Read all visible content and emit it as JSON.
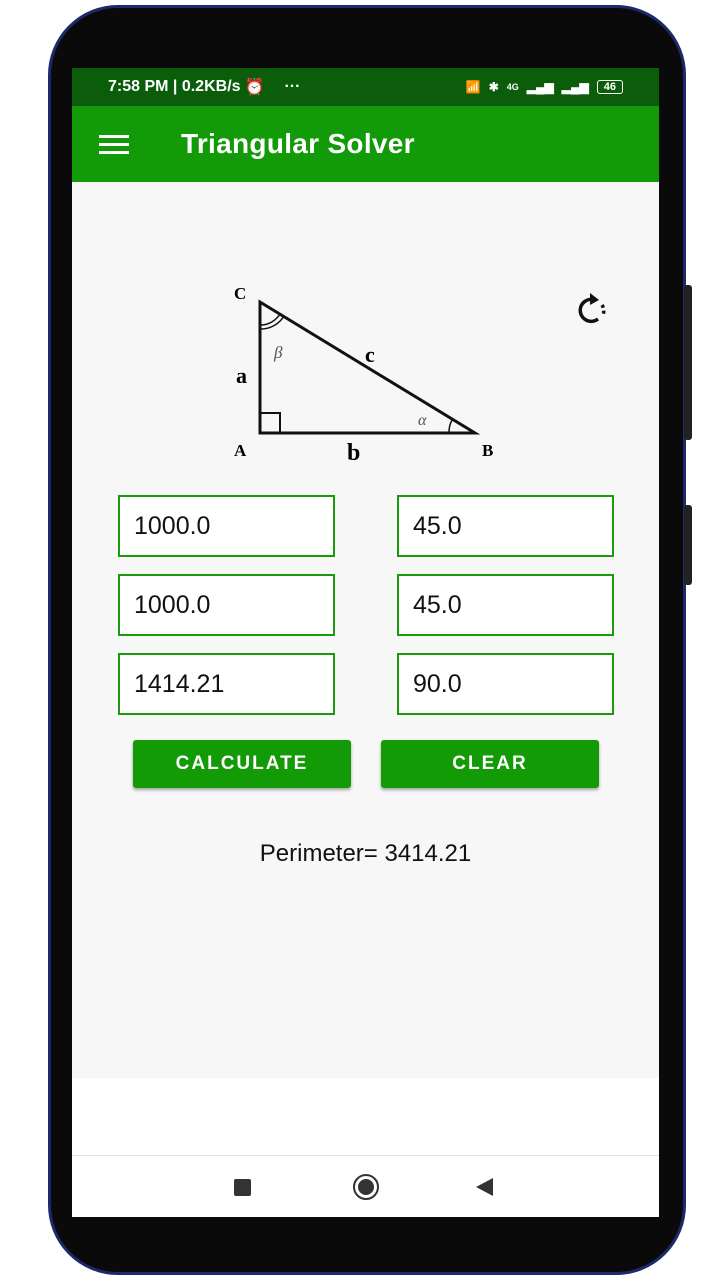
{
  "status_bar": {
    "time": "7:58 PM | 0.2KB/s",
    "more": "···",
    "network": "4G",
    "battery": "46"
  },
  "app_bar": {
    "title": "Triangular Solver"
  },
  "diagram": {
    "vertices": [
      "C",
      "A",
      "B"
    ],
    "sides": [
      "a",
      "b",
      "c"
    ],
    "angles": [
      "β",
      "α"
    ]
  },
  "fields": {
    "side_a": "1000.0",
    "side_b": "1000.0",
    "side_c": "1414.21",
    "angle_alpha": "45.0",
    "angle_beta": "45.0",
    "angle_gamma": "90.0"
  },
  "buttons": {
    "calculate": "CALCULATE",
    "clear": "CLEAR"
  },
  "result": "Perimeter= 3414.21",
  "colors": {
    "status_bar": "#0b5c0b",
    "app_bar": "#129a08",
    "field_border": "#1c9a0e"
  }
}
